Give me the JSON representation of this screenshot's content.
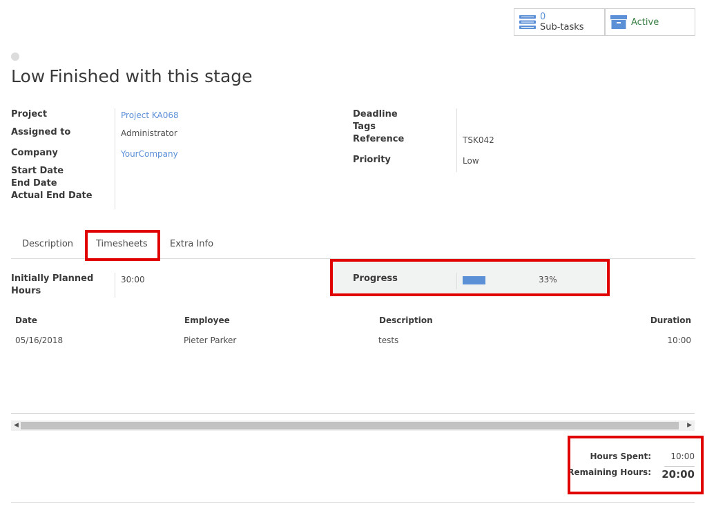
{
  "stat_buttons": {
    "subtasks": {
      "count": "0",
      "label": "Sub-tasks",
      "icon": "tasks-icon"
    },
    "active": {
      "label": "Active",
      "icon": "archive-icon"
    }
  },
  "task": {
    "priority": "Low",
    "name": "Finished with this stage"
  },
  "fields_left": {
    "project_label": "Project",
    "project_value": "Project KA068",
    "assigned_label": "Assigned to",
    "assigned_value": "Administrator",
    "company_label": "Company",
    "company_value": "YourCompany",
    "start_label": "Start Date",
    "end_label": "End Date",
    "actual_end_label": "Actual End Date"
  },
  "fields_right": {
    "deadline_label": "Deadline",
    "tags_label": "Tags",
    "reference_label": "Reference",
    "reference_value": "TSK042",
    "priority_label": "Priority",
    "priority_value": "Low"
  },
  "tabs": [
    {
      "label": "Description"
    },
    {
      "label": "Timesheets"
    },
    {
      "label": "Extra Info"
    }
  ],
  "timesheets": {
    "planned_label_1": "Initially Planned",
    "planned_label_2": "Hours",
    "planned_value": "30:00",
    "progress_label": "Progress",
    "progress_percent": 33,
    "progress_text": "33%",
    "columns": [
      "Date",
      "Employee",
      "Description",
      "Duration"
    ],
    "rows": [
      {
        "date": "05/16/2018",
        "employee": "Pieter Parker",
        "description": "tests",
        "duration": "10:00"
      }
    ]
  },
  "totals": {
    "hours_spent_label": "Hours Spent:",
    "hours_spent_value": "10:00",
    "remaining_label": "Remaining Hours:",
    "remaining_value": "20:00"
  },
  "colors": {
    "link": "#5b8fd6",
    "active_green": "#3a8044",
    "highlight_red": "#e00000",
    "progress_fill": "#5b8fd6"
  }
}
